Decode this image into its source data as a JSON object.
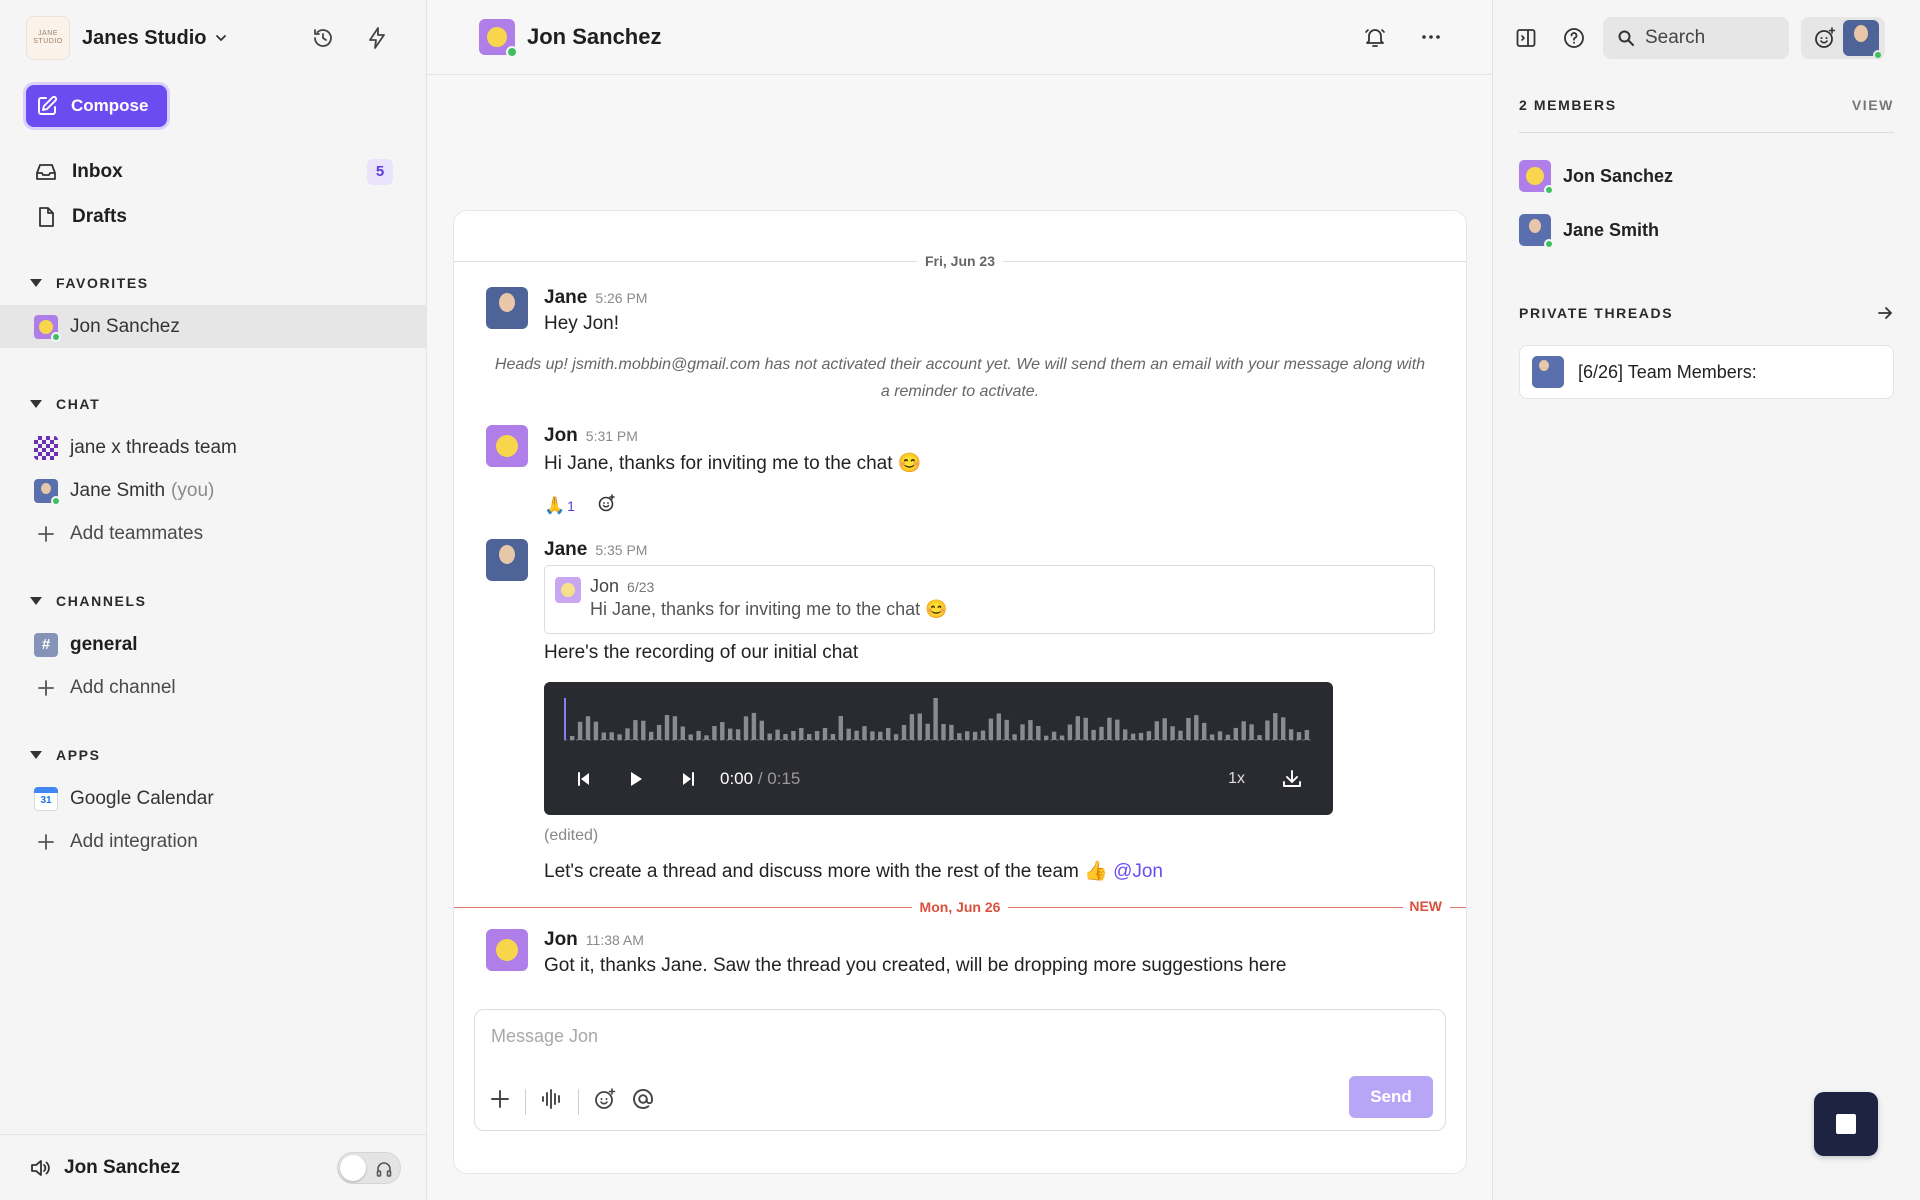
{
  "workspace": {
    "logo_text": "JANE STUDIO",
    "name": "Janes Studio"
  },
  "sidebar": {
    "compose_label": "Compose",
    "nav": [
      {
        "label": "Inbox",
        "badge": "5"
      },
      {
        "label": "Drafts"
      }
    ],
    "favorites": {
      "title": "FAVORITES",
      "items": [
        {
          "label": "Jon Sanchez"
        }
      ]
    },
    "chat": {
      "title": "CHAT",
      "items": [
        {
          "label": "jane x threads team"
        },
        {
          "label": "Jane Smith",
          "suffix": "(you)"
        }
      ],
      "add_label": "Add teammates"
    },
    "channels": {
      "title": "CHANNELS",
      "items": [
        {
          "icon_text": "#",
          "label": "general"
        }
      ],
      "add_label": "Add channel"
    },
    "apps": {
      "title": "APPS",
      "items": [
        {
          "icon_text": "31",
          "label": "Google Calendar"
        }
      ],
      "add_label": "Add integration"
    },
    "footer": {
      "label": "Jon Sanchez"
    }
  },
  "chat": {
    "title": "Jon Sanchez",
    "date_1": "Fri, Jun 23",
    "messages": [
      {
        "author": "Jane",
        "time": "5:26 PM",
        "text": "Hey Jon!"
      },
      {
        "author": "Jon",
        "time": "5:31 PM",
        "text": "Hi Jane, thanks for inviting me to the chat 😊",
        "reaction_emoji": "🙏",
        "reaction_count": "1"
      },
      {
        "author": "Jane",
        "time": "5:35 PM",
        "quote": {
          "author": "Jon",
          "date": "6/23",
          "text": "Hi Jane, thanks for inviting me to the chat 😊"
        },
        "text": "Here's the recording of our initial chat",
        "audio": {
          "current": "0:00",
          "duration": "/ 0:15",
          "speed": "1x"
        },
        "edited": "(edited)",
        "text_2": "Let's create a thread and discuss more with the rest of the team 👍",
        "mention": "@Jon"
      },
      {
        "author": "Jon",
        "time": "11:38 AM",
        "text": "Got it, thanks Jane. Saw the thread you created, will be dropping more suggestions here"
      }
    ],
    "notice": "Heads up! jsmith.mobbin@gmail.com has not activated their account yet. We will send them an email with your message along with a reminder to activate.",
    "date_2": "Mon, Jun 26",
    "new_tag": "NEW",
    "composer": {
      "placeholder": "Message Jon",
      "send_label": "Send"
    }
  },
  "right": {
    "search_label": "Search",
    "members_title": "2 MEMBERS",
    "view_label": "VIEW",
    "members": [
      {
        "name": "Jon Sanchez"
      },
      {
        "name": "Jane Smith"
      }
    ],
    "threads_title": "PRIVATE THREADS",
    "thread_label": "[6/26] Team Members:"
  },
  "colors": {
    "accent": "#6b4cf0",
    "new": "#d9523f",
    "online": "#3fbf62"
  }
}
